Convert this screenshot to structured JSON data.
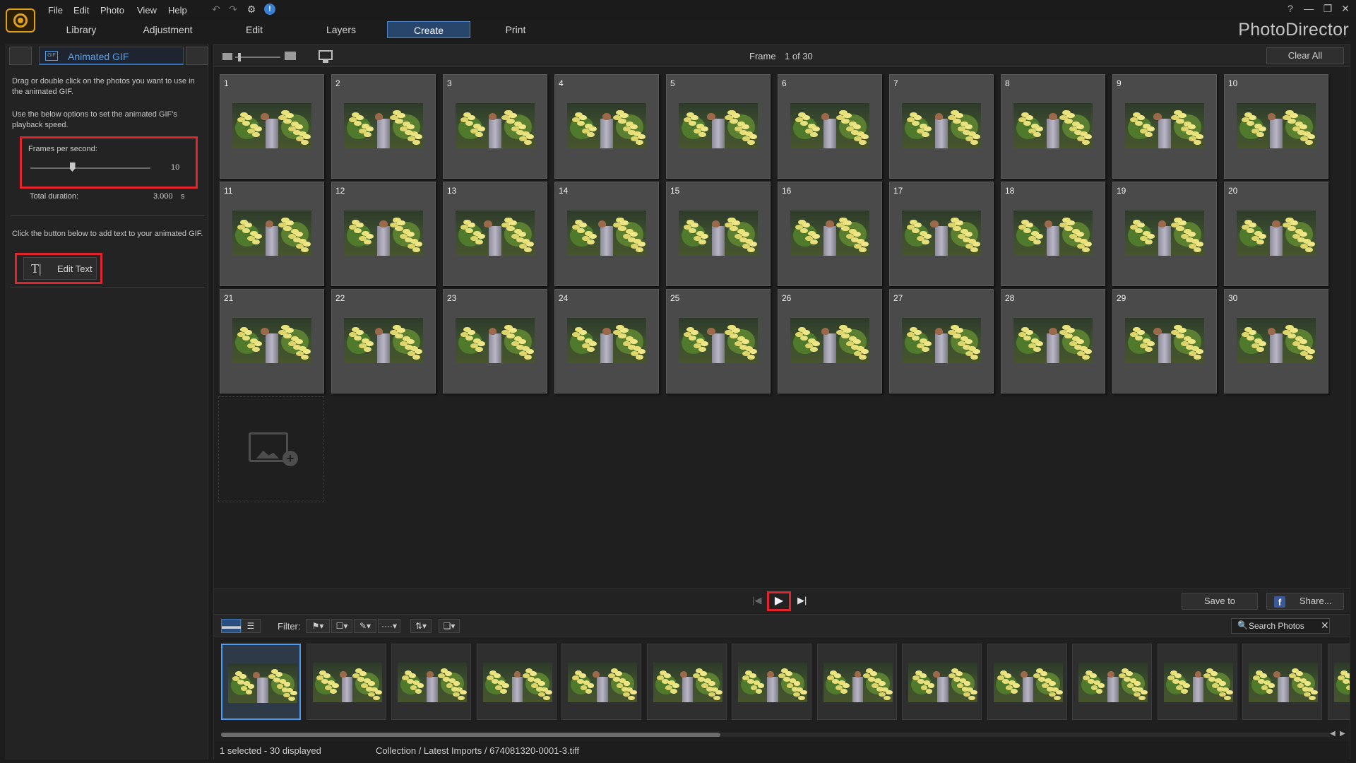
{
  "app": {
    "brand": "PhotoDirector"
  },
  "menu": [
    "File",
    "Edit",
    "Photo",
    "View",
    "Help"
  ],
  "window_controls": [
    "?",
    "—",
    "❐",
    "✕"
  ],
  "modules": [
    {
      "label": "Library"
    },
    {
      "label": "Adjustment"
    },
    {
      "label": "Edit"
    },
    {
      "label": "Layers"
    },
    {
      "label": "Create",
      "active": true
    },
    {
      "label": "Print"
    }
  ],
  "left_panel": {
    "tab_title": "Animated GIF",
    "gif_badge": "GIF",
    "instructions_1": "Drag or double click on the photos you want to use in the animated GIF.",
    "instructions_2": "Use the below options to set the animated GIF's playback speed.",
    "fps_label": "Frames per second:",
    "fps_value": "10",
    "fps_level": 0.35,
    "duration_label": "Total duration:",
    "duration_value": "3.000",
    "duration_unit": "s",
    "text_instructions": "Click the button below to add text to your animated GIF.",
    "edit_text_icon": "T|",
    "edit_text_label": "Edit Text"
  },
  "frame_toolbar": {
    "frame_label": "Frame",
    "frame_value": "1 of 30",
    "clear_all_label": "Clear All"
  },
  "frames": [
    "1",
    "2",
    "3",
    "4",
    "5",
    "6",
    "7",
    "8",
    "9",
    "10",
    "11",
    "12",
    "13",
    "14",
    "15",
    "16",
    "17",
    "18",
    "19",
    "20",
    "21",
    "22",
    "23",
    "24",
    "25",
    "26",
    "27",
    "28",
    "29",
    "30"
  ],
  "playback": {
    "prev_icon": "|◀",
    "play_icon": "▶",
    "next_icon": "▶|",
    "save_to_label": "Save to",
    "share_label": "Share...",
    "fb_icon": "f"
  },
  "browser_toolbar": {
    "filter_label": "Filter:",
    "search_placeholder": "Search Photos",
    "search_icon": "🔍",
    "clear_icon": "✕"
  },
  "film_strip": {
    "visible_thumbs": 14,
    "selected_index": 0,
    "scroll_level": 0.45
  },
  "status": {
    "selected_text": "1 selected - 30 displayed",
    "path_text": "Collection / Latest Imports / 674081320-0001-3.tiff"
  },
  "colors": {
    "accent": "#4c9bf0",
    "active_tab": "#28466c",
    "highlight_red": "#e0262c",
    "logo": "#e1a21b"
  }
}
